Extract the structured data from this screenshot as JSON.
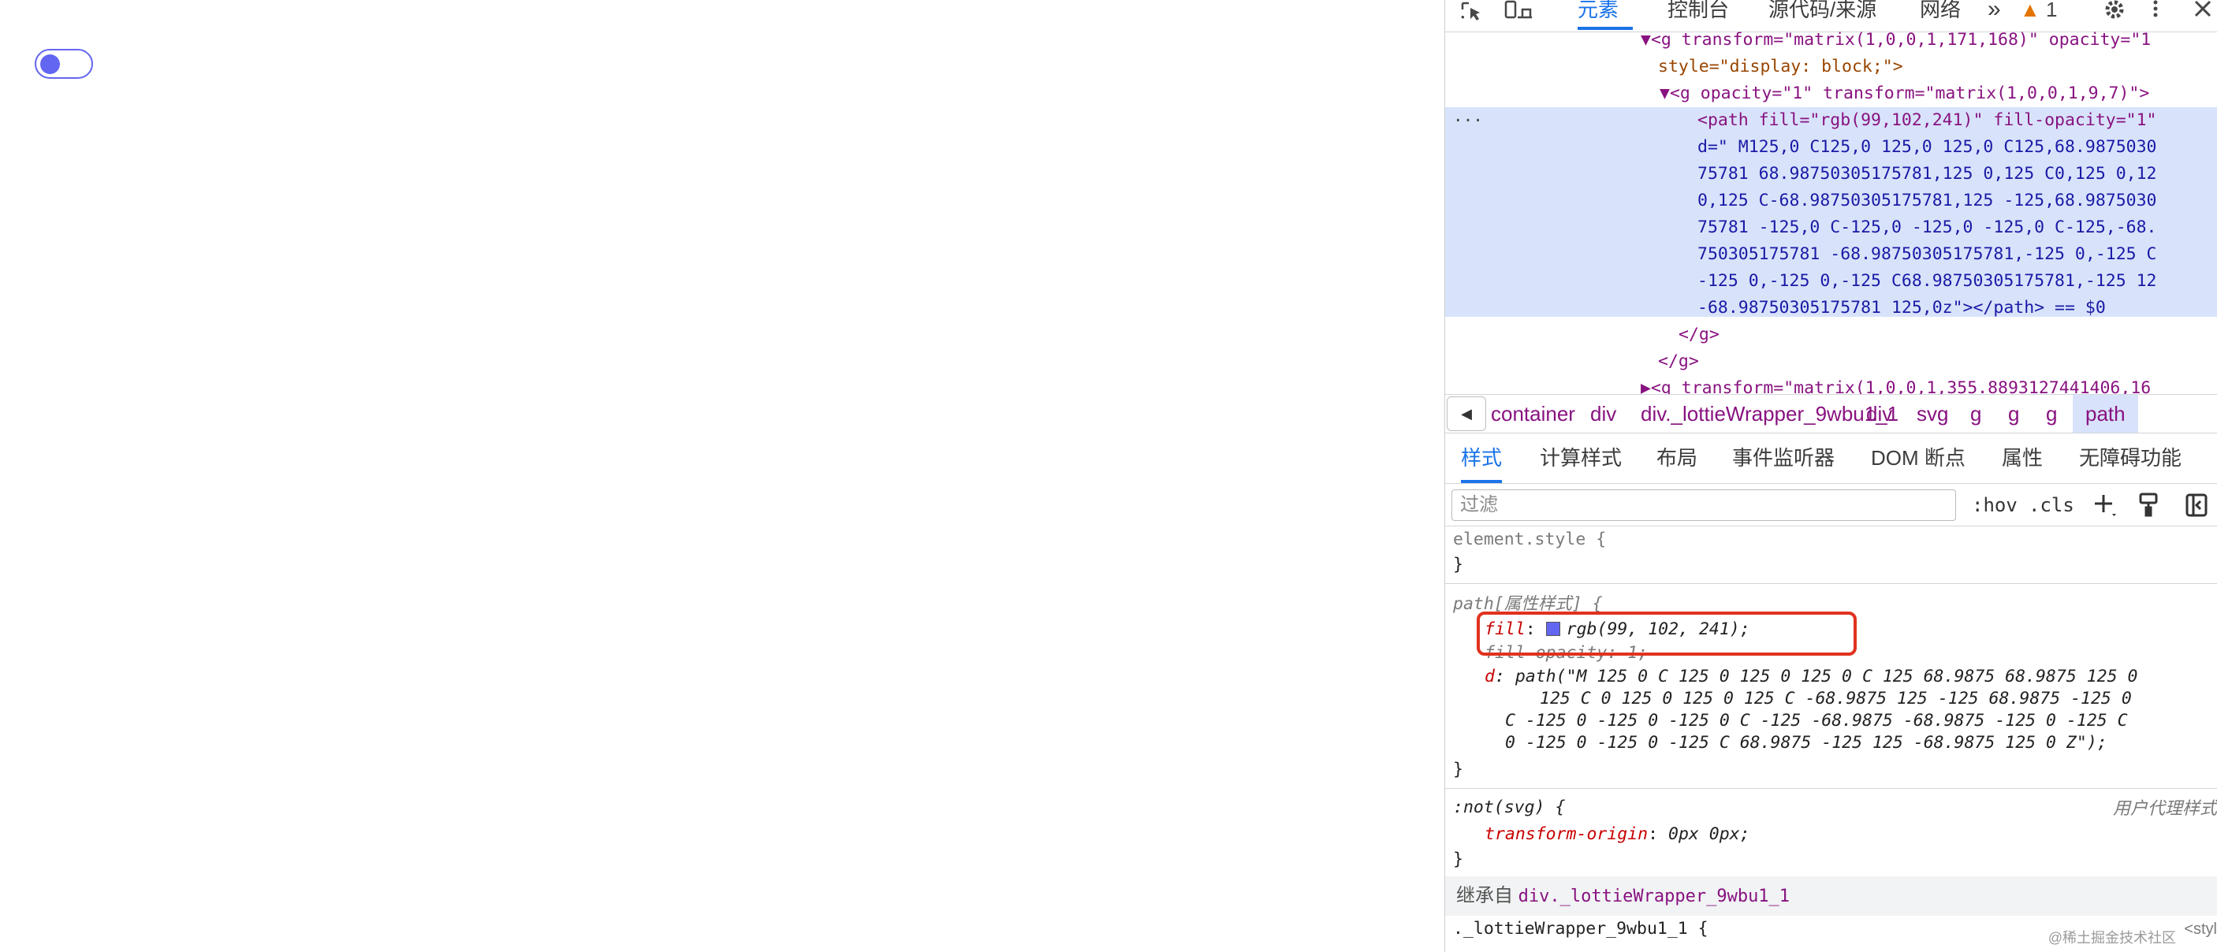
{
  "toggle": {
    "state": "off",
    "accent": "#6366f1"
  },
  "devtools": {
    "toolbar": {
      "inspect_icon": "inspect-element-icon",
      "device_icon": "device-toolbar-icon",
      "tabs": [
        "元素",
        "控制台",
        "源代码/来源",
        "网络"
      ],
      "more": "»",
      "warning_count": "1",
      "settings_icon": "gear-icon",
      "menu_icon": "kebab-menu-icon",
      "close_icon": "close-icon"
    },
    "dom": {
      "ellipsis": "···",
      "lines": [
        {
          "text": "▼<g transform=\"matrix(1,0,0,1,171,168)\" opacity=\"1"
        },
        {
          "text": "style=\"display: block;\">"
        },
        {
          "text": "▼<g opacity=\"1\" transform=\"matrix(1,0,0,1,9,7)\">"
        },
        {
          "text": "<path fill=\"rgb(99,102,241)\" fill-opacity=\"1\""
        },
        {
          "text": "d=\" M125,0 C125,0 125,0 125,0 C125,68.9875030"
        },
        {
          "text": "75781 68.98750305175781,125 0,125 C0,125 0,12"
        },
        {
          "text": "0,125 C-68.98750305175781,125 -125,68.9875030"
        },
        {
          "text": "75781 -125,0 C-125,0 -125,0 -125,0 C-125,-68."
        },
        {
          "text": "750305175781 -68.98750305175781,-125 0,-125 C"
        },
        {
          "text": "-125 0,-125 0,-125 C68.98750305175781,-125 12"
        },
        {
          "text": "-68.98750305175781 125,0z\"></path> == $0"
        },
        {
          "text": "</g>"
        },
        {
          "text": "</g>"
        },
        {
          "text": "▶<g transform=\"matrix(1,0,0,1,355.8893127441406,16"
        }
      ]
    },
    "breadcrumbs": {
      "back_icon": "triangle-left-icon",
      "items": [
        "container",
        "div",
        "div._lottieWrapper_9wbu1_1",
        "div",
        "svg",
        "g",
        "g",
        "g",
        "path"
      ]
    },
    "sub_tabs": [
      "样式",
      "计算样式",
      "布局",
      "事件监听器",
      "DOM 断点",
      "属性",
      "无障碍功能"
    ],
    "filter": {
      "placeholder": "过滤",
      "hov": ":hov",
      "cls": ".cls",
      "add_icon": "plus-icon",
      "paint_icon": "paint-brush-icon",
      "sidebar_icon": "toggle-sidebar-icon"
    },
    "styles": {
      "element_style_selector": "element.style {",
      "close_brace": "}",
      "path_selector": "path[属性样式] {",
      "fill_prop": "fill",
      "fill_value": "rgb(99, 102, 241);",
      "fill_opacity_prop": "fill-opacity",
      "fill_opacity_value": "1;",
      "d_prop": "d",
      "d_value_lines": [
        "path(\"M 125 0 C 125 0 125 0 125 0 C 125 68.9875 68.9875 125 0",
        "125 C 0 125 0 125 0 125 C -68.9875 125 -125 68.9875 -125 0",
        "C -125 0 -125 0 -125 0 C -125 -68.9875 -68.9875 -125 0 -125 C",
        "0 -125 0 -125 0 -125 C 68.9875 -125 125 -68.9875 125 0 Z\");"
      ],
      "not_svg_selector": ":not(svg) {",
      "user_agent_label": "用户代理样式",
      "transform_origin_prop": "transform-origin",
      "transform_origin_value": "0px 0px;",
      "inherited_label": "继承自",
      "inherited_from": "div._lottieWrapper_9wbu1_1",
      "lottie_selector": "._lottieWrapper_9wbu1_1 {",
      "style_link": "<styl"
    },
    "watermark": "@稀土掘金技术社区"
  }
}
